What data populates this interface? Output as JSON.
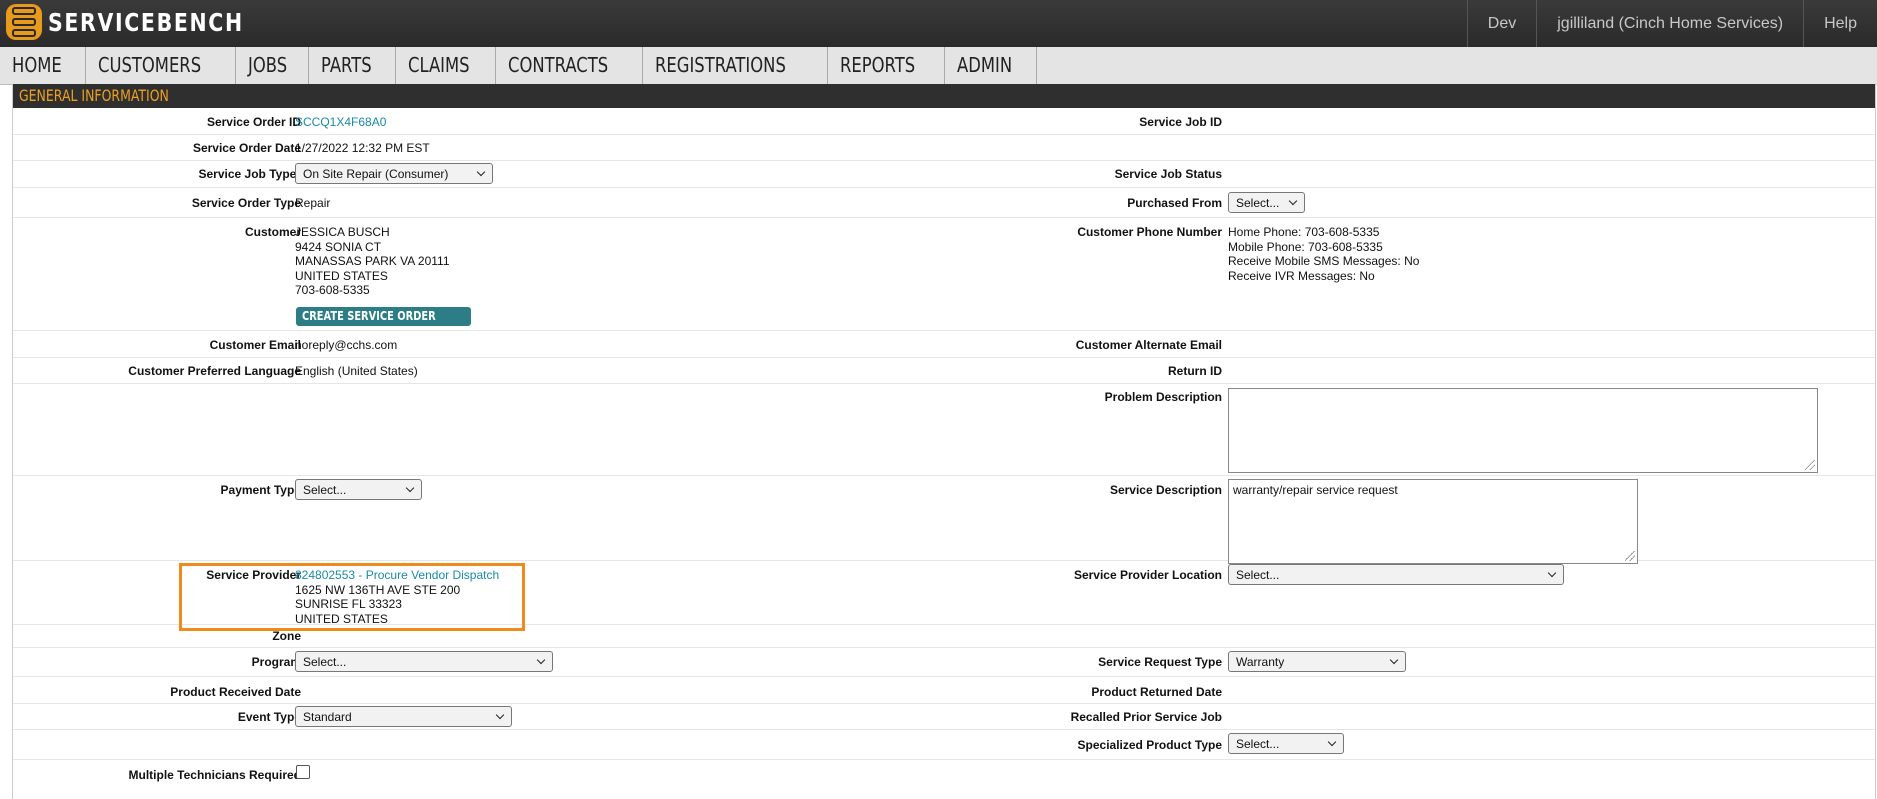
{
  "app": {
    "logo_text": "SERVICEBENCH"
  },
  "topbar": {
    "env": "Dev",
    "user": "jgilliland (Cinch Home Services)",
    "help": "Help"
  },
  "nav": [
    "HOME",
    "CUSTOMERS",
    "JOBS",
    "PARTS",
    "CLAIMS",
    "CONTRACTS",
    "REGISTRATIONS",
    "REPORTS",
    "ADMIN"
  ],
  "section": {
    "title": "GENERAL INFORMATION"
  },
  "fields": {
    "service_order_id": {
      "label": "Service Order ID",
      "value": "SCCQ1X4F68A0"
    },
    "service_job_id": {
      "label": "Service Job ID"
    },
    "service_order_date": {
      "label": "Service Order Date",
      "value": "1/27/2022 12:32 PM EST"
    },
    "service_job_type": {
      "label": "Service Job Type*",
      "value": "On Site Repair (Consumer)"
    },
    "service_job_status": {
      "label": "Service Job Status"
    },
    "service_order_type": {
      "label": "Service Order Type",
      "value": "Repair"
    },
    "purchased_from": {
      "label": "Purchased From",
      "value": "Select..."
    },
    "customer": {
      "label": "Customer",
      "lines": [
        "JESSICA BUSCH",
        "9424 SONIA CT",
        "MANASSAS PARK VA 20111",
        "UNITED STATES",
        "703-608-5335"
      ],
      "button": "CREATE SERVICE ORDER"
    },
    "customer_phone": {
      "label": "Customer Phone Number",
      "lines": [
        "Home Phone: 703-608-5335",
        "Mobile Phone: 703-608-5335",
        "Receive Mobile SMS Messages: No",
        "Receive IVR Messages: No"
      ]
    },
    "customer_email": {
      "label": "Customer Email",
      "value": "noreply@cchs.com"
    },
    "customer_alt_email": {
      "label": "Customer Alternate Email"
    },
    "preferred_language": {
      "label": "Customer Preferred Language",
      "value": "English (United States)"
    },
    "return_id": {
      "label": "Return ID"
    },
    "problem_description": {
      "label": "Problem Description",
      "value": ""
    },
    "payment_type": {
      "label": "Payment Type",
      "value": "Select..."
    },
    "service_description": {
      "label": "Service Description",
      "value": "warranty/repair service request"
    },
    "service_provider": {
      "label": "Service Provider",
      "link": "824802553 - Procure Vendor Dispatch",
      "lines": [
        "1625 NW 136TH AVE STE 200",
        "SUNRISE FL 33323",
        "UNITED STATES"
      ]
    },
    "service_provider_location": {
      "label": "Service Provider Location",
      "value": "Select..."
    },
    "zone": {
      "label": "Zone"
    },
    "program": {
      "label": "Program",
      "value": "Select..."
    },
    "service_request_type": {
      "label": "Service Request Type",
      "value": "Warranty"
    },
    "product_received_date": {
      "label": "Product Received Date"
    },
    "product_returned_date": {
      "label": "Product Returned Date"
    },
    "event_type": {
      "label": "Event Type",
      "value": "Standard"
    },
    "recalled_prior_job": {
      "label": "Recalled Prior Service Job"
    },
    "specialized_product_type": {
      "label": "Specialized Product Type",
      "value": "Select..."
    },
    "multiple_technicians": {
      "label": "Multiple Technicians Required",
      "checked": false
    }
  },
  "colors": {
    "accent": "#f0a020",
    "link": "#1a8aa8",
    "button": "#2d7d86",
    "highlight": "#f08a1c"
  }
}
